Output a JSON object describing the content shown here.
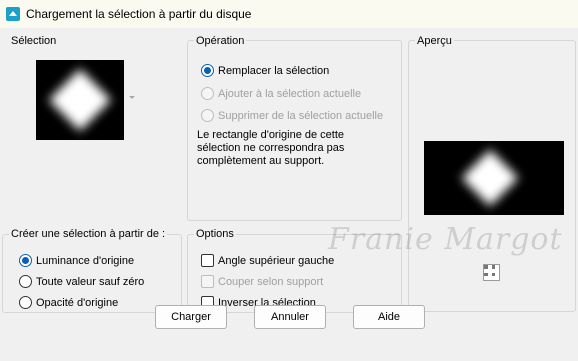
{
  "window": {
    "title": "Chargement la sélection à partir du disque"
  },
  "selection_group": {
    "label": "Sélection"
  },
  "operation_group": {
    "label": "Opération",
    "options": [
      {
        "label": "Remplacer la sélection",
        "checked": true,
        "enabled": true
      },
      {
        "label": "Ajouter à la sélection actuelle",
        "checked": false,
        "enabled": false
      },
      {
        "label": "Supprimer de la sélection actuelle",
        "checked": false,
        "enabled": false
      }
    ],
    "info_lines": [
      "Le rectangle d'origine de cette",
      "sélection ne correspondra pas",
      "complètement au support."
    ]
  },
  "preview_group": {
    "label": "Aperçu"
  },
  "create_group": {
    "label": "Créer une sélection à partir de :",
    "options": [
      {
        "label": "Luminance d'origine",
        "checked": true
      },
      {
        "label": "Toute valeur sauf zéro",
        "checked": false
      },
      {
        "label": "Opacité d'origine",
        "checked": false
      }
    ]
  },
  "options_group": {
    "label": "Options",
    "checks": [
      {
        "label": "Angle supérieur gauche",
        "checked": false,
        "enabled": true
      },
      {
        "label": "Couper selon support",
        "checked": false,
        "enabled": false
      },
      {
        "label": "Inverser la sélection",
        "checked": false,
        "enabled": true
      }
    ]
  },
  "watermark": "Franie Margot",
  "buttons": {
    "load": "Charger",
    "cancel": "Annuler",
    "help": "Aide"
  },
  "colors": {
    "accent": "#0a5fb4",
    "title_icon": "#1ba0c8"
  }
}
